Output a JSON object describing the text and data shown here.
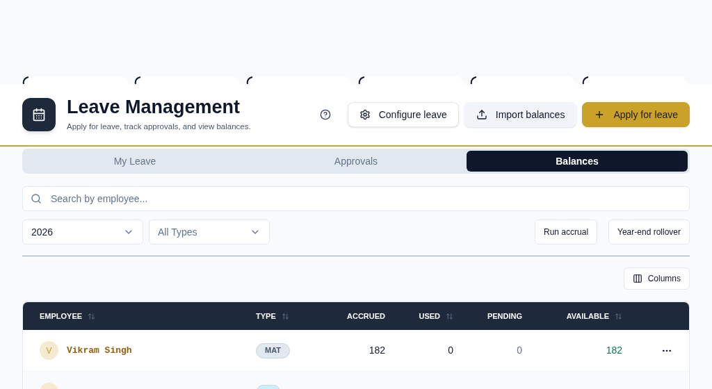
{
  "summary_cards": [
    {
      "kind": "loading"
    },
    {
      "kind": "loading"
    },
    {
      "kind": "loading"
    },
    {
      "kind": "loading"
    },
    {
      "kind": "loading"
    },
    {
      "kind": "loading"
    }
  ],
  "header": {
    "title": "Leave Management",
    "subtitle": "Apply for leave, track approvals, and view balances.",
    "buttons": [
      {
        "label": "Configure leave",
        "kind": "outline"
      },
      {
        "label": "Import balances",
        "kind": "secondary"
      },
      {
        "label": "Apply for leave",
        "kind": "primary"
      }
    ]
  },
  "tabs": [
    {
      "label": "My Leave",
      "selected": false
    },
    {
      "label": "Approvals",
      "selected": false
    },
    {
      "label": "Balances",
      "selected": true
    }
  ],
  "search": {
    "placeholder": "Search by employee..."
  },
  "filters": [
    {
      "value": "2026",
      "placeholder": false
    },
    {
      "value": "All Types",
      "placeholder": true
    }
  ],
  "actions": [
    "Run accrual",
    "Year-end rollover"
  ],
  "columns_button": "Columns",
  "table": {
    "columns": [
      {
        "label": "EMPLOYEE",
        "sortable": true
      },
      {
        "label": "TYPE",
        "sortable": true
      },
      {
        "label": "ACCRUED",
        "sortable": false
      },
      {
        "label": "USED",
        "sortable": true
      },
      {
        "label": "PENDING",
        "sortable": false
      },
      {
        "label": "AVAILABLE",
        "sortable": true
      }
    ],
    "rows": [
      {
        "initial": "V",
        "name": "Vikram Singh",
        "type": "MAT",
        "color": "#e2e8f0",
        "accrued": "182",
        "used": "0",
        "pending": "0",
        "available": "182"
      },
      {
        "initial": "",
        "name": "",
        "type": "",
        "color": "#cdeefe",
        "accrued": "",
        "used": "",
        "pending": "",
        "available": ""
      }
    ]
  }
}
